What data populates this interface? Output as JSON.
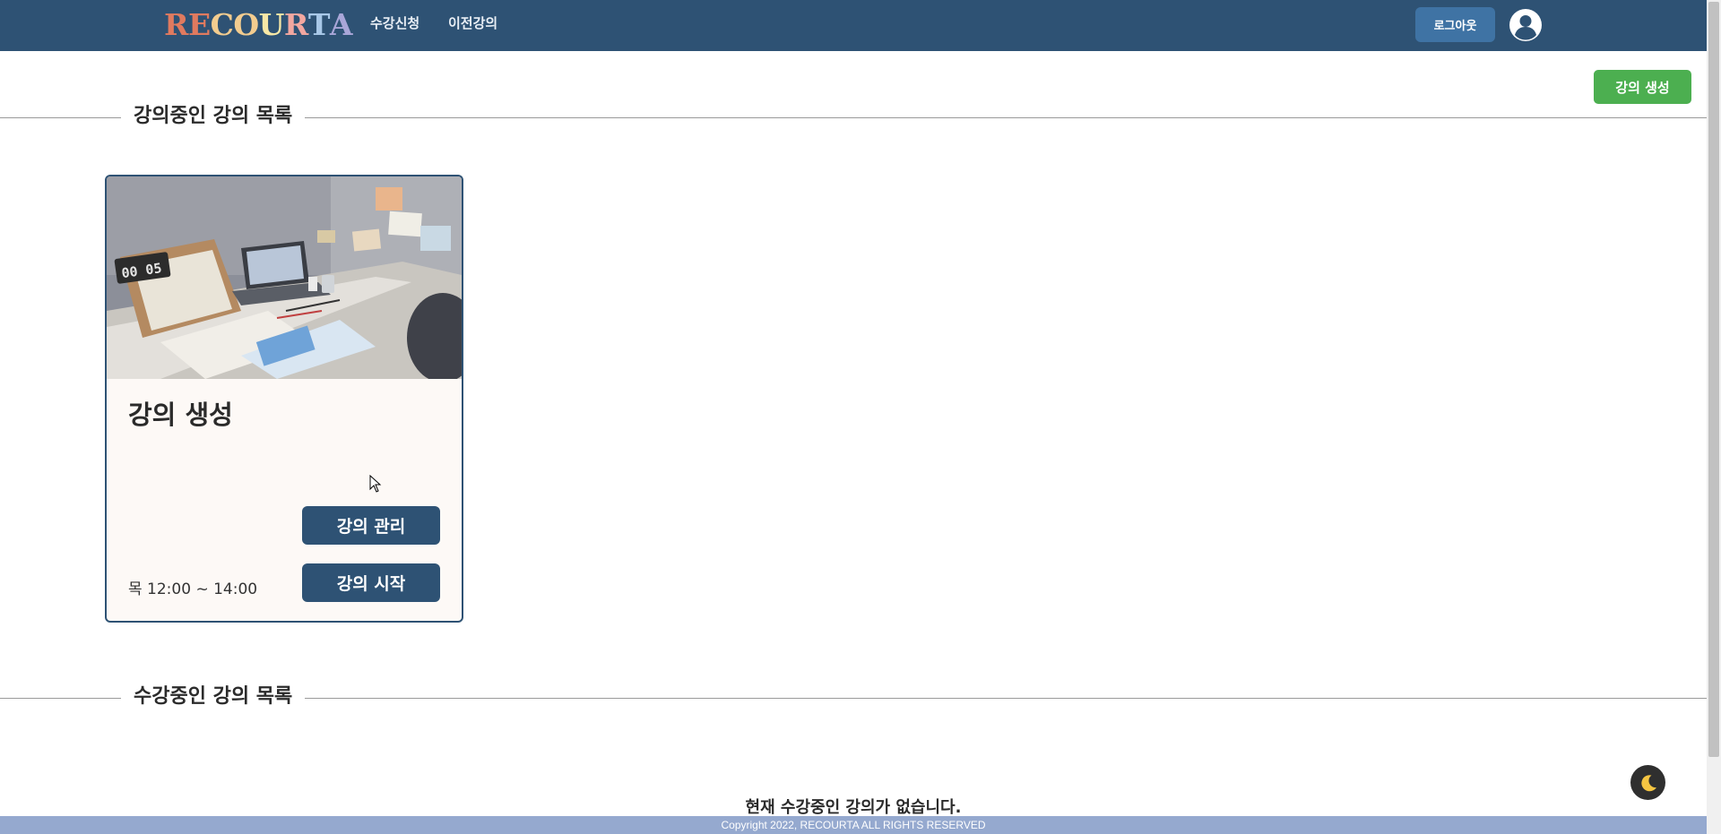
{
  "header": {
    "logo": [
      "R",
      "E",
      "C",
      "O",
      "U",
      "R",
      "T",
      "A"
    ],
    "logo_colors": [
      "#e07a5f",
      "#e07a5f",
      "#f2cc8f",
      "#f2cc8f",
      "#f7e8a6",
      "#f2a7a0",
      "#a8c8e8",
      "#a9a6d8"
    ],
    "nav": {
      "apply": "수강신청",
      "previous": "이전강의"
    },
    "logout_label": "로그아웃",
    "profile_icon": "user-circle-icon"
  },
  "actions": {
    "create_course_label": "강의 생성"
  },
  "sections": {
    "teaching_title": "강의중인 강의 목록",
    "enrolled_title": "수강중인 강의 목록",
    "enrolled_empty": "현재 수강중인 강의가 없습니다."
  },
  "courses": [
    {
      "title": "강의 생성",
      "schedule": "목 12:00 ~ 14:00",
      "manage_label": "강의 관리",
      "start_label": "강의 시작"
    }
  ],
  "theme_toggle_icon": "moon-icon",
  "footer": {
    "copyright": "Copyright 2022, RECOURTA ALL RIGHTS RESERVED"
  },
  "colors": {
    "header_bg": "#2e5274",
    "primary": "#2e5274",
    "logout_bg": "#3f73a4",
    "create_bg": "#4caf50",
    "footer_bg": "#95a9cf",
    "card_bg": "#fdf9f6"
  }
}
